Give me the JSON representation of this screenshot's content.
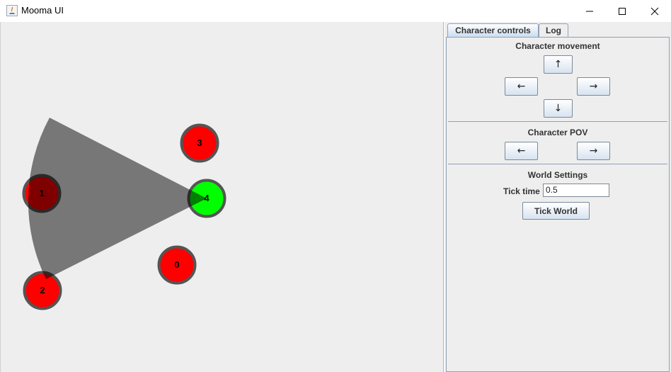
{
  "window": {
    "title": "Mooma UI",
    "controls": [
      "minimize-icon",
      "maximize-icon",
      "close-icon"
    ]
  },
  "canvas": {
    "characters": [
      {
        "id": "0",
        "color": "#ff0000"
      },
      {
        "id": "1",
        "color": "#ff0000",
        "shaded": true
      },
      {
        "id": "2",
        "color": "#ff0000"
      },
      {
        "id": "3",
        "color": "#ff0000"
      },
      {
        "id": "4",
        "color": "#00ff00",
        "selected": true
      }
    ],
    "pov_cone_color": "#777777",
    "ring_color": "#555555"
  },
  "tabs": [
    {
      "label": "Character controls",
      "active": true
    },
    {
      "label": "Log",
      "active": false
    }
  ],
  "movement": {
    "title": "Character movement",
    "up": "↑",
    "left": "←",
    "right": "→",
    "down": "↓"
  },
  "pov": {
    "title": "Character POV",
    "left": "←",
    "right": "→"
  },
  "world": {
    "title": "World Settings",
    "tick_time_label": "Tick time",
    "tick_time_value": "0.5",
    "tick_button": "Tick World"
  }
}
